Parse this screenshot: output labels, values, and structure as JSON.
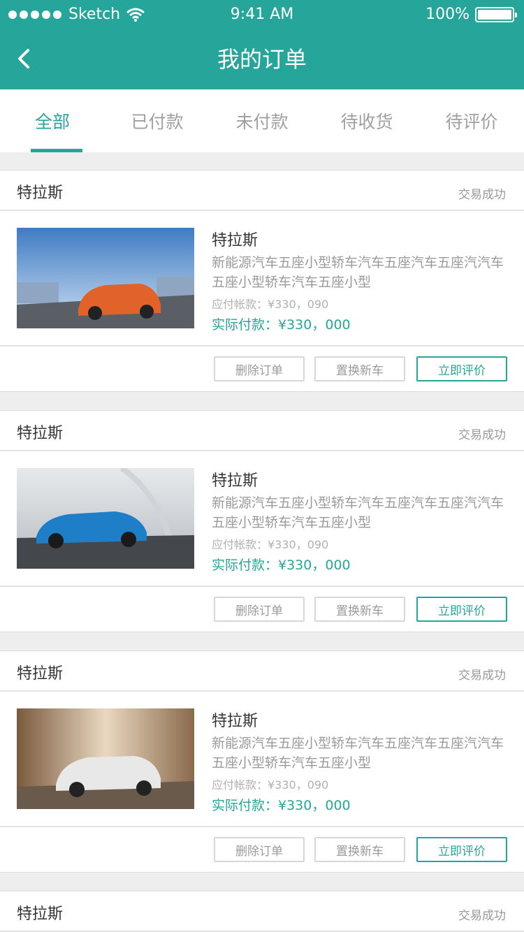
{
  "status_bar": {
    "carrier": "Sketch",
    "time": "9:41 AM",
    "battery": "100%"
  },
  "nav": {
    "title": "我的订单",
    "back_icon": "chevron-left-icon"
  },
  "tabs": [
    {
      "label": "全部",
      "active": true
    },
    {
      "label": "已付款",
      "active": false
    },
    {
      "label": "未付款",
      "active": false
    },
    {
      "label": "待收货",
      "active": false
    },
    {
      "label": "待评价",
      "active": false
    }
  ],
  "colors": {
    "accent": "#26a69a",
    "muted": "#9a9a9a"
  },
  "orders": [
    {
      "shop": "特拉斯",
      "status": "交易成功",
      "car_color": "#e2632a",
      "title": "特拉斯",
      "desc": "新能源汽车五座小型轿车汽车五座汽车五座汽汽车五座小型轿车汽车五座小型",
      "due": "应付帐款：¥330，090",
      "paid": "实际付款：¥330，000",
      "btn_delete": "删除订单",
      "btn_trade": "置换新车",
      "btn_review": "立即评价"
    },
    {
      "shop": "特拉斯",
      "status": "交易成功",
      "car_color": "#1e7fc8",
      "title": "特拉斯",
      "desc": "新能源汽车五座小型轿车汽车五座汽车五座汽汽车五座小型轿车汽车五座小型",
      "due": "应付帐款：¥330，090",
      "paid": "实际付款：¥330，000",
      "btn_delete": "删除订单",
      "btn_trade": "置换新车",
      "btn_review": "立即评价"
    },
    {
      "shop": "特拉斯",
      "status": "交易成功",
      "car_color": "#e8e8e8",
      "title": "特拉斯",
      "desc": "新能源汽车五座小型轿车汽车五座汽车五座汽汽车五座小型轿车汽车五座小型",
      "due": "应付帐款：¥330，090",
      "paid": "实际付款：¥330，000",
      "btn_delete": "删除订单",
      "btn_trade": "置换新车",
      "btn_review": "立即评价"
    },
    {
      "shop": "特拉斯",
      "status": "交易成功"
    }
  ]
}
